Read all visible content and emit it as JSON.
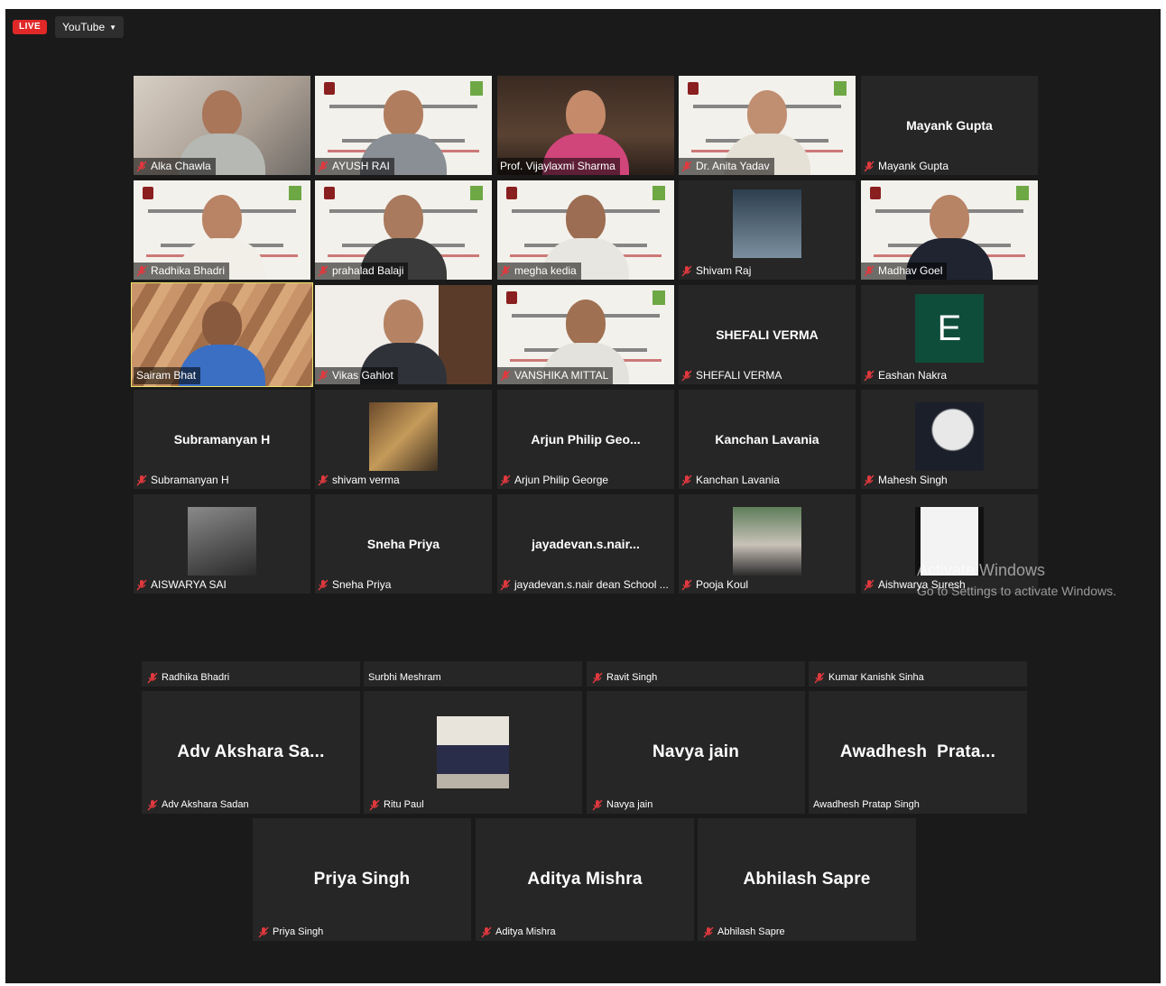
{
  "top_bar": {
    "live_label": "LIVE",
    "stream_label": "YouTube"
  },
  "gallery": [
    {
      "display": "video",
      "label": "Alka Chawla",
      "muted": true
    },
    {
      "display": "video",
      "label": "AYUSH RAI",
      "muted": true
    },
    {
      "display": "video",
      "label": "Prof. Vijaylaxmi Sharma",
      "muted": false
    },
    {
      "display": "video",
      "label": "Dr. Anita Yadav",
      "muted": true
    },
    {
      "display": "name",
      "name": "Mayank Gupta",
      "label": "Mayank Gupta",
      "muted": true
    },
    {
      "display": "video",
      "label": "Radhika Bhadri",
      "muted": true
    },
    {
      "display": "video",
      "label": "prahalad Balaji",
      "muted": true
    },
    {
      "display": "video",
      "label": "megha kedia",
      "muted": true
    },
    {
      "display": "photo",
      "label": "Shivam Raj",
      "muted": true
    },
    {
      "display": "video",
      "label": "Madhav Goel",
      "muted": true
    },
    {
      "display": "video",
      "label": "Sairam Bhat",
      "muted": false,
      "active_speaker": true
    },
    {
      "display": "video",
      "label": "Vikas Gahlot",
      "muted": true
    },
    {
      "display": "video",
      "label": "VANSHIKA MITTAL",
      "muted": true
    },
    {
      "display": "name",
      "name": "SHEFALI VERMA",
      "label": "SHEFALI VERMA",
      "muted": true
    },
    {
      "display": "avatar",
      "initial": "E",
      "label": "Eashan Nakra",
      "muted": true
    },
    {
      "display": "name",
      "name": "Subramanyan H",
      "label": "Subramanyan H",
      "muted": true
    },
    {
      "display": "photo",
      "label": "shivam verma",
      "muted": true
    },
    {
      "display": "name",
      "name": "Arjun Philip Geo...",
      "label": "Arjun Philip George",
      "muted": true
    },
    {
      "display": "name",
      "name": "Kanchan Lavania",
      "label": "Kanchan Lavania",
      "muted": true
    },
    {
      "display": "photo",
      "label": "Mahesh Singh",
      "muted": true
    },
    {
      "display": "photo",
      "label": "AISWARYA SAI",
      "muted": true
    },
    {
      "display": "name",
      "name": "Sneha Priya",
      "label": "Sneha Priya",
      "muted": true
    },
    {
      "display": "name",
      "name": "jayadevan.s.nair...",
      "label": "jayadevan.s.nair dean School ...",
      "muted": true
    },
    {
      "display": "photo",
      "label": "Pooja Koul",
      "muted": true
    },
    {
      "display": "photo",
      "label": "Aishwarya Suresh",
      "muted": true
    }
  ],
  "strip": [
    {
      "label": "Radhika Bhadri",
      "muted": true
    },
    {
      "label": "Surbhi Meshram",
      "muted": false
    },
    {
      "label": "Ravit Singh",
      "muted": true
    },
    {
      "label": "Kumar Kanishk Sinha",
      "muted": true
    }
  ],
  "lower": [
    {
      "display": "name",
      "name": "Adv Akshara Sa...",
      "label": "Adv Akshara Sadan",
      "muted": true
    },
    {
      "display": "photo",
      "label": "Ritu Paul",
      "muted": true
    },
    {
      "display": "name",
      "name": "Navya jain",
      "label": "Navya jain",
      "muted": true
    },
    {
      "display": "name",
      "name": "Awadhesh  Prata...",
      "label": "Awadhesh Pratap Singh",
      "muted": false
    },
    {
      "display": "name",
      "name": "Priya Singh",
      "label": "Priya Singh",
      "muted": true
    },
    {
      "display": "name",
      "name": "Aditya Mishra",
      "label": "Aditya Mishra",
      "muted": true
    },
    {
      "display": "name",
      "name": "Abhilash Sapre",
      "label": "Abhilash Sapre",
      "muted": true
    }
  ],
  "watermark": {
    "title": "Activate Windows",
    "subtitle": "Go to Settings to activate Windows."
  },
  "colors": {
    "background": "#1a1a1a",
    "tile": "#262626",
    "live_red": "#e02828",
    "muted_icon": "#e0393e",
    "active_speaker_border": "#f0e36a"
  }
}
